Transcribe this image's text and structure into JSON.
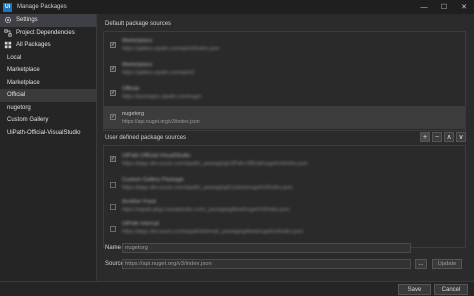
{
  "window": {
    "title": "Manage Packages",
    "logo_text": "Ui",
    "minimize": "—",
    "maximize": "☐",
    "close": "✕"
  },
  "sidebar": {
    "items": [
      {
        "label": "Settings",
        "icon": "gear-icon"
      },
      {
        "label": "Project Dependencies",
        "icon": "dependencies-icon"
      },
      {
        "label": "All Packages",
        "icon": "packages-grid-icon"
      },
      {
        "label": "Local"
      },
      {
        "label": "Marketplace"
      },
      {
        "label": "Marketplace"
      },
      {
        "label": "Official"
      },
      {
        "label": "nugetorg"
      },
      {
        "label": "Custom Gallery"
      },
      {
        "label": "UiPath-Official-VisualStudio"
      }
    ]
  },
  "default_sources": {
    "title": "Default package sources",
    "items": [
      {
        "name": "Marketplace",
        "url": "https://gallery.uipath.com/api/v3/index.json",
        "checked": true,
        "blurred": true
      },
      {
        "name": "Marketplace",
        "url": "https://gallery.uipath.com/api/v2",
        "checked": true,
        "blurred": true
      },
      {
        "name": "Official",
        "url": "https://packages.uipath.com/nuget",
        "checked": true,
        "blurred": true
      },
      {
        "name": "nugetorg",
        "url": "https://api.nuget.org/v3/index.json",
        "checked": true,
        "blurred": false
      }
    ]
  },
  "user_sources": {
    "title": "User defined package sources",
    "tools": {
      "add": "+",
      "remove": "−",
      "up": "∧",
      "down": "∨"
    },
    "items": [
      {
        "name": "UiPath-Official-VisualStudio",
        "url": "https://pkgs.dev.azure.com/uipath/_packaging/UiPath-Official/nuget/v3/index.json",
        "checked": true
      },
      {
        "name": "Custom Gallery Package",
        "url": "https://pkgs.dev.azure.com/uipath/_packaging/Custom/nuget/v3/index.json",
        "checked": false
      },
      {
        "name": "Another Feed",
        "url": "https://uipath.pkgs.visualstudio.com/_packaging/feed/nuget/v3/index.json",
        "checked": false
      },
      {
        "name": "UiPath Internal",
        "url": "https://pkgs.dev.azure.com/uipath/internal/_packaging/feed/nuget/v3/index.json",
        "checked": false
      }
    ]
  },
  "form": {
    "name_label": "Name",
    "name_value": "nugetorg",
    "source_label": "Source",
    "source_value": "https://api.nuget.org/v3/index.json",
    "browse_label": "...",
    "update_label": "Update"
  },
  "footer": {
    "save_label": "Save",
    "cancel_label": "Cancel"
  }
}
